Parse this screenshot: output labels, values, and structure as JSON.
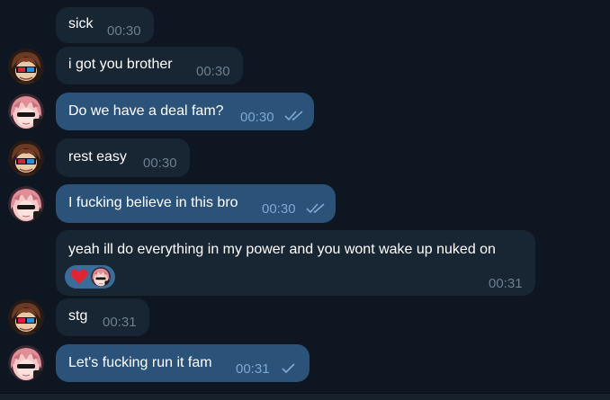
{
  "messages": [
    {
      "text": "sick",
      "time": "00:30",
      "direction": "in",
      "avatar": "none"
    },
    {
      "text": "i got you brother",
      "time": "00:30",
      "direction": "in",
      "avatar": "brown-hair-3d-glasses"
    },
    {
      "text": "Do we have a deal fam?",
      "time": "00:30",
      "direction": "out",
      "status": "read-double-check",
      "avatar": "pink-hair-sunglasses"
    },
    {
      "text": "rest easy",
      "time": "00:30",
      "direction": "in",
      "avatar": "brown-hair-3d-glasses"
    },
    {
      "text": "I fucking believe in this bro",
      "time": "00:30",
      "direction": "out",
      "status": "read-double-check",
      "avatar": "pink-hair-sunglasses"
    },
    {
      "text": "yeah ill do everything in my power and you wont wake up nuked on",
      "time": "00:31",
      "direction": "in",
      "avatar": "none",
      "reactions": [
        {
          "type": "heart-emoji"
        },
        {
          "type": "reactor-avatar"
        }
      ]
    },
    {
      "text": "stg",
      "time": "00:31",
      "direction": "in",
      "avatar": "brown-hair-3d-glasses"
    },
    {
      "text": "Let's fucking run it fam",
      "time": "00:31",
      "direction": "out",
      "status": "sent-single-check",
      "avatar": "pink-hair-sunglasses"
    }
  ],
  "colors": {
    "background": "#0e1621",
    "incoming_bubble": "#182533",
    "outgoing_bubble": "#2b5278",
    "incoming_time": "#6d7f8f",
    "outgoing_time": "#7da8d3",
    "reaction_pill": "#3a6d99"
  }
}
